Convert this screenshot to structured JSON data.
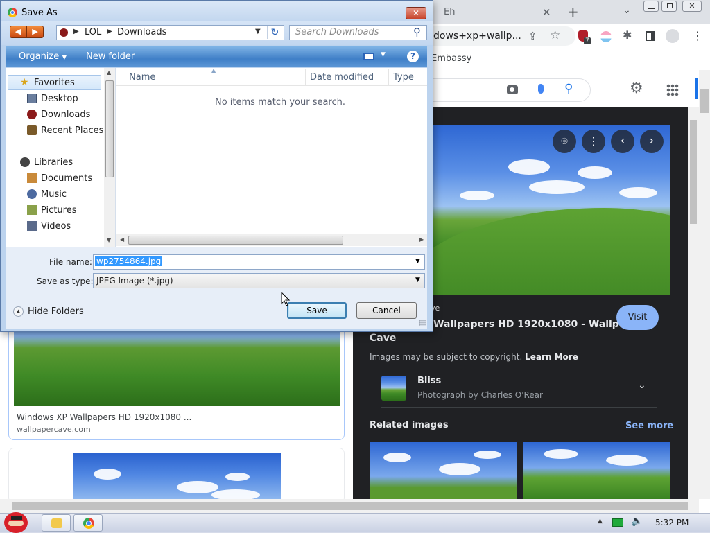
{
  "chrome": {
    "tab_title": "Eh",
    "omnibox_text": "dows+xp+wallp...",
    "bookmark_label": "Embassy",
    "extension_badge": "7"
  },
  "left_result": {
    "title": "Windows XP Wallpapers HD 1920x1080 ...",
    "source": "wallpapercave.com"
  },
  "panel": {
    "source_suffix": "ve",
    "title_line1": "Wallpapers HD 1920x1080 - Wallpaper",
    "title_line2": "Cave",
    "visit_label": "Visit",
    "copyright_text": "Images may be subject to copyright.",
    "learn_more": "Learn More",
    "entity_title": "Bliss",
    "entity_sub": "Photograph by Charles O'Rear",
    "related_title": "Related images",
    "see_more": "See more"
  },
  "dialog": {
    "title": "Save As",
    "breadcrumb_1": "LOL",
    "breadcrumb_2": "Downloads",
    "search_placeholder": "Search Downloads",
    "organize_label": "Organize",
    "new_folder_label": "New folder",
    "nav": {
      "favorites": "Favorites",
      "desktop": "Desktop",
      "downloads": "Downloads",
      "recent": "Recent Places",
      "libraries": "Libraries",
      "documents": "Documents",
      "music": "Music",
      "pictures": "Pictures",
      "videos": "Videos"
    },
    "columns": {
      "name": "Name",
      "date": "Date modified",
      "type": "Type"
    },
    "empty_message": "No items match your search.",
    "filename_label": "File name:",
    "filename_value": "wp2754864.jpg",
    "type_label": "Save as type:",
    "type_value": "JPEG Image (*.jpg)",
    "hide_folders": "Hide Folders",
    "save_label": "Save",
    "cancel_label": "Cancel"
  },
  "taskbar": {
    "clock": "5:32 PM"
  },
  "colors": {
    "chrome_blue": "#1a73e8",
    "panel_bg": "#202124",
    "visit_button": "#8ab4f8",
    "selection": "#3399ff"
  }
}
